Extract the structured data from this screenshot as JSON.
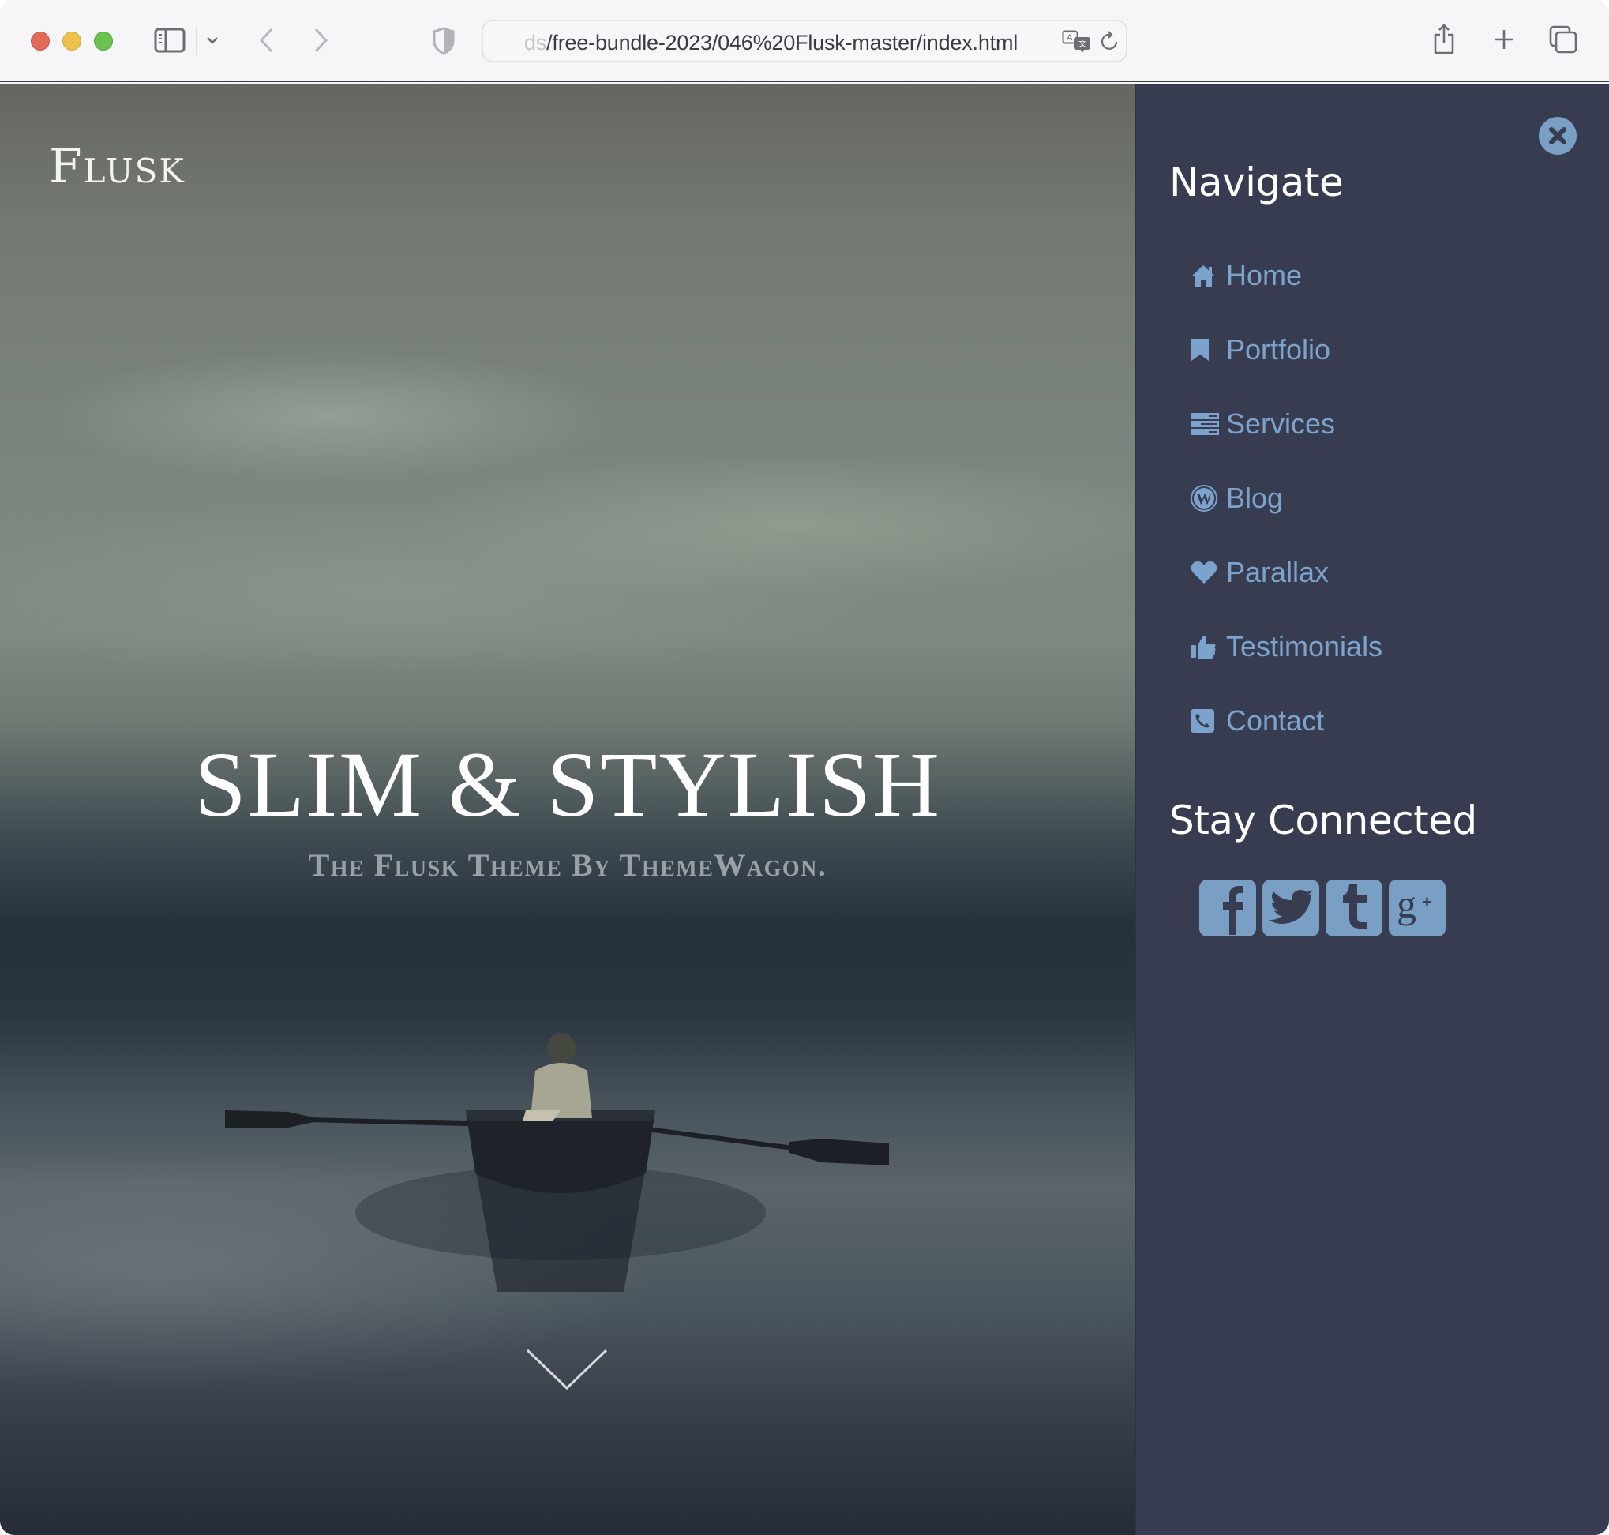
{
  "browser": {
    "url_prefix_faded": "ds",
    "url": "/free-bundle-2023/046%20Flusk-master/index.html",
    "icons": [
      "sidebar-icon",
      "chevron-down-icon",
      "back-icon",
      "forward-icon",
      "privacy-shield-icon",
      "translate-icon",
      "reload-icon",
      "share-icon",
      "new-tab-icon",
      "tab-overview-icon"
    ]
  },
  "hero": {
    "brand": "Flusk",
    "headline": "SLIM & STYLISH",
    "subheadline": "The Flusk Theme By ThemeWagon.",
    "scroll_icon": "chevron-down-icon"
  },
  "menu": {
    "close_icon": "close-icon",
    "navigate_heading": "Navigate",
    "items": [
      {
        "label": "Home",
        "icon": "home-icon"
      },
      {
        "label": "Portfolio",
        "icon": "bookmark-icon"
      },
      {
        "label": "Services",
        "icon": "server-icon"
      },
      {
        "label": "Blog",
        "icon": "wordpress-icon"
      },
      {
        "label": "Parallax",
        "icon": "heart-icon"
      },
      {
        "label": "Testimonials",
        "icon": "thumbs-up-icon"
      },
      {
        "label": "Contact",
        "icon": "phone-icon"
      }
    ],
    "social_heading": "Stay Connected",
    "social": [
      {
        "name": "Facebook",
        "icon": "facebook-icon"
      },
      {
        "name": "Twitter",
        "icon": "twitter-icon"
      },
      {
        "name": "Tumblr",
        "icon": "tumblr-icon"
      },
      {
        "name": "Google+",
        "icon": "google-plus-icon"
      }
    ]
  },
  "colors": {
    "menu_bg": "#373c50",
    "menu_accent": "#7ba3cc",
    "headline": "#ffffff",
    "subheadline": "#9aa0a8"
  }
}
